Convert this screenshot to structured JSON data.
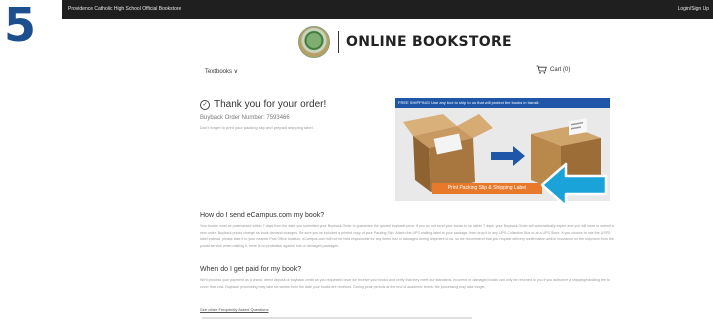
{
  "step": {
    "number": "5"
  },
  "topbar": {
    "store_name": "Providence Catholic High School Official Bookstore",
    "login": "Login/Sign Up"
  },
  "header": {
    "logo_text": "ONLINE BOOKSTORE",
    "nav_textbooks": "Textbooks ∨",
    "cart_label": "Cart (0)"
  },
  "confirmation": {
    "title": "Thank you for your order!",
    "order_number": "Buyback Order Number: 7593466",
    "hint": "Don't forget to print your packing slip and prepaid shipping label."
  },
  "promo": {
    "banner": "FREE SHIPPING! Use any box to ship to us that will protect the books in transit.",
    "button_label": "Print Packing Slip & Shipping Label"
  },
  "sections": {
    "send_heading": "How do I send eCampus.com my book?",
    "send_body": "Your books must be postmarked within 7 days from the date you submitted your Buyback Order to guarantee the quoted buyback price. If you do not send your books to us within 7 days, your Buyback Order will automatically expire and you will need to submit a new order. Buyback prices change as book demand changes. Be sure you've included a printed copy of your Packing Slip. Attach the UPS mailing label to your package, then drop it in any UPS Collection Box or at a UPS Store. If you choose to use the USPS label instead, please take it to your nearest Post Office location. eCampus.com will not be held responsible for any items lost or damaged during shipment to us, so we recommend that you request delivery confirmation and/or insurance on the shipment from the postal service when mailing it, there is no protection against lost or damaged packages.",
    "paid_heading": "When do I get paid for my book?",
    "paid_body": "We'll process your payment as a check, direct deposit or buyback credit as you requested once we receive your books and verify that they meet our standards. Incorrect or damaged books can only be returned to you if you authorize a shipping/handling fee to cover that cost. Buyback processing may take six weeks from the date your books are received. During peak periods at the end of academic terms, the processing may take longer.",
    "faq_link": "See other Frequently Asked Questions"
  },
  "colors": {
    "step_blue": "#1d4f8e",
    "topbar": "#1f1f1f",
    "banner_blue": "#1f56a8",
    "button_orange": "#e8782a",
    "callout_cyan": "#1aa3d9"
  }
}
